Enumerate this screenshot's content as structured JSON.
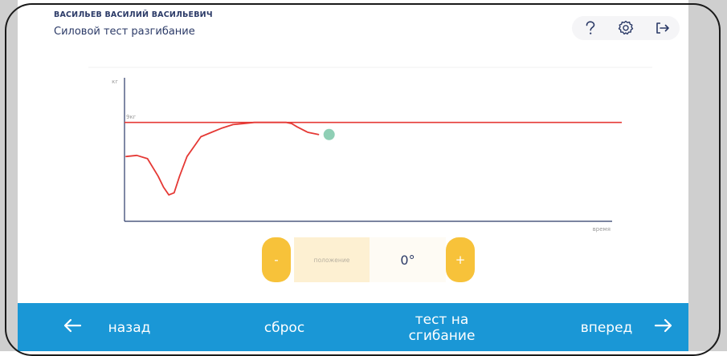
{
  "header": {
    "user_name": "ВАСИЛЬЕВ ВАСИЛИЙ ВАСИЛЬЕВИЧ",
    "test_title": "Силовой тест разгибание"
  },
  "toolbar": {
    "help_icon": "question-icon",
    "settings_icon": "gear-icon",
    "logout_icon": "logout-icon"
  },
  "chart_data": {
    "type": "line",
    "ylabel": "кг",
    "xlabel": "время",
    "threshold_label": "9кг",
    "threshold_value": 9,
    "ylim": [
      0,
      12
    ],
    "series": [
      {
        "x": [
          0,
          1,
          2,
          3,
          3.5,
          4,
          4.5,
          5,
          5.7,
          6.5,
          7,
          8,
          9,
          10,
          11,
          12,
          13,
          14,
          15,
          15.5,
          16,
          17,
          18
        ],
        "values": [
          5.9,
          6.0,
          5.7,
          4.1,
          3.1,
          2.4,
          2.6,
          4.1,
          5.9,
          7.0,
          7.7,
          8.1,
          8.5,
          8.8,
          8.9,
          9.0,
          9.0,
          9.0,
          9.0,
          8.9,
          8.6,
          8.1,
          7.9
        ]
      }
    ],
    "current_point": {
      "x": 19,
      "y": 7.9
    },
    "colors": {
      "line": "#e53935",
      "threshold": "#e53935",
      "point": "#8fcfb5",
      "axis": "#2b3a67"
    }
  },
  "position_control": {
    "minus_label": "-",
    "plus_label": "+",
    "label": "положение",
    "value": "0°"
  },
  "bottom_nav": {
    "back_label": "назад",
    "reset_label": "сброс",
    "flex_test_line1": "тест на",
    "flex_test_line2": "сгибание",
    "forward_label": "вперед"
  },
  "colors": {
    "accent_blue": "#1a97d6",
    "accent_yellow": "#f7c23a",
    "text_dark": "#2b3a67"
  }
}
